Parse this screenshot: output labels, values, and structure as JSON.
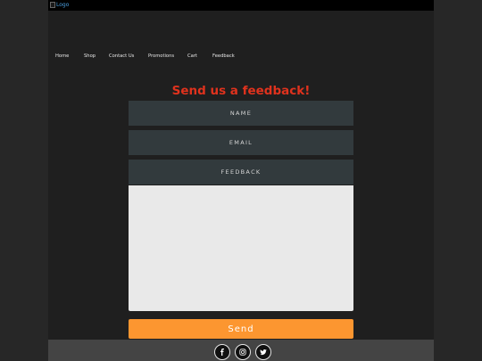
{
  "header": {
    "logo_alt": "Logo"
  },
  "nav": {
    "items": [
      {
        "label": "Home"
      },
      {
        "label": "Shop"
      },
      {
        "label": "Contact Us"
      },
      {
        "label": "Promotions"
      },
      {
        "label": "Cart"
      },
      {
        "label": "Feedback"
      }
    ]
  },
  "form": {
    "title": "Send us a feedback!",
    "name_placeholder": "NAME",
    "email_placeholder": "EMAIL",
    "feedback_placeholder": "FEEDBACK",
    "message_value": "",
    "send_label": "Send"
  },
  "footer": {
    "social": [
      {
        "icon": "facebook-icon"
      },
      {
        "icon": "instagram-icon"
      },
      {
        "icon": "twitter-icon"
      }
    ]
  },
  "colors": {
    "accent_title": "#e0321d",
    "send_button": "#fc9630",
    "field_bg": "#323a3d",
    "page_bg": "#1f1f1f"
  }
}
